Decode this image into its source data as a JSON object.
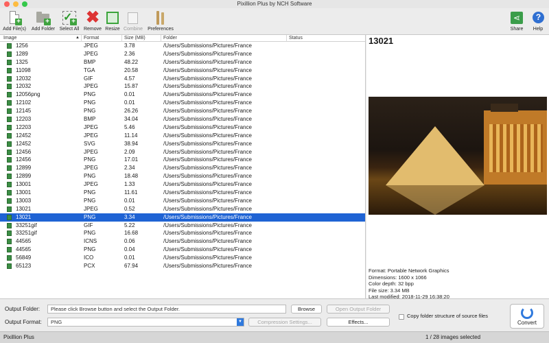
{
  "window": {
    "title": "Pixillion Plus by NCH Software"
  },
  "toolbar": {
    "add_files": "Add File(s)",
    "add_folder": "Add Folder",
    "select_all": "Select All",
    "remove": "Remove",
    "resize": "Resize",
    "combine": "Combine",
    "preferences": "Preferences",
    "share": "Share",
    "help": "Help"
  },
  "table": {
    "columns": [
      "Image",
      "Format",
      "Size (MB)",
      "Folder",
      "Status"
    ],
    "rows": [
      [
        "1256",
        "JPEG",
        "3.78",
        "/Users/Submissions/Pictures/France"
      ],
      [
        "1289",
        "JPEG",
        "2.36",
        "/Users/Submissions/Pictures/France"
      ],
      [
        "1325",
        "BMP",
        "48.22",
        "/Users/Submissions/Pictures/France"
      ],
      [
        "11098",
        "TGA",
        "20.58",
        "/Users/Submissions/Pictures/France"
      ],
      [
        "12032",
        "GIF",
        "4.57",
        "/Users/Submissions/Pictures/France"
      ],
      [
        "12032",
        "JPEG",
        "15.87",
        "/Users/Submissions/Pictures/France"
      ],
      [
        "12056png",
        "PNG",
        "0.01",
        "/Users/Submissions/Pictures/France"
      ],
      [
        "12102",
        "PNG",
        "0.01",
        "/Users/Submissions/Pictures/France"
      ],
      [
        "12145",
        "PNG",
        "26.26",
        "/Users/Submissions/Pictures/France"
      ],
      [
        "12203",
        "BMP",
        "34.04",
        "/Users/Submissions/Pictures/France"
      ],
      [
        "12203",
        "JPEG",
        "5.46",
        "/Users/Submissions/Pictures/France"
      ],
      [
        "12452",
        "JPEG",
        "11.14",
        "/Users/Submissions/Pictures/France"
      ],
      [
        "12452",
        "SVG",
        "38.94",
        "/Users/Submissions/Pictures/France"
      ],
      [
        "12456",
        "JPEG",
        "2.09",
        "/Users/Submissions/Pictures/France"
      ],
      [
        "12456",
        "PNG",
        "17.01",
        "/Users/Submissions/Pictures/France"
      ],
      [
        "12899",
        "JPEG",
        "2.34",
        "/Users/Submissions/Pictures/France"
      ],
      [
        "12899",
        "PNG",
        "18.48",
        "/Users/Submissions/Pictures/France"
      ],
      [
        "13001",
        "JPEG",
        "1.33",
        "/Users/Submissions/Pictures/France"
      ],
      [
        "13001",
        "PNG",
        "11.61",
        "/Users/Submissions/Pictures/France"
      ],
      [
        "13003",
        "PNG",
        "0.01",
        "/Users/Submissions/Pictures/France"
      ],
      [
        "13021",
        "JPEG",
        "0.52",
        "/Users/Submissions/Pictures/France"
      ],
      [
        "13021",
        "PNG",
        "3.34",
        "/Users/Submissions/Pictures/France"
      ],
      [
        "33251gif",
        "GIF",
        "5.22",
        "/Users/Submissions/Pictures/France"
      ],
      [
        "33251gif",
        "PNG",
        "16.68",
        "/Users/Submissions/Pictures/France"
      ],
      [
        "44565",
        "ICNS",
        "0.06",
        "/Users/Submissions/Pictures/France"
      ],
      [
        "44565",
        "PNG",
        "0.04",
        "/Users/Submissions/Pictures/France"
      ],
      [
        "56849",
        "ICO",
        "0.01",
        "/Users/Submissions/Pictures/France"
      ],
      [
        "65123",
        "PCX",
        "67.94",
        "/Users/Submissions/Pictures/France"
      ]
    ],
    "selected_index": 21
  },
  "preview": {
    "title": "13021",
    "format": "Format: Portable Network Graphics",
    "dimensions": "Dimensions: 1600 x 1066",
    "color_depth": "Color depth: 32 bpp",
    "file_size": "File size: 3.34 MB",
    "last_modified": "Last modified: 2018-11-29 16:38:20"
  },
  "output": {
    "folder_label": "Output Folder:",
    "folder_value": "Please click Browse button and select the Output Folder.",
    "browse": "Browse",
    "open_folder": "Open Output Folder",
    "format_label": "Output Format:",
    "format_value": "PNG",
    "compression": "Compression Settings...",
    "effects": "Effects...",
    "copy_structure": "Copy folder structure of source files",
    "convert": "Convert"
  },
  "status": {
    "app": "Pixillion Plus",
    "selection": "1 / 28 images selected"
  },
  "colors": {
    "selection": "#1f63d4",
    "accent": "#2f79dd"
  }
}
